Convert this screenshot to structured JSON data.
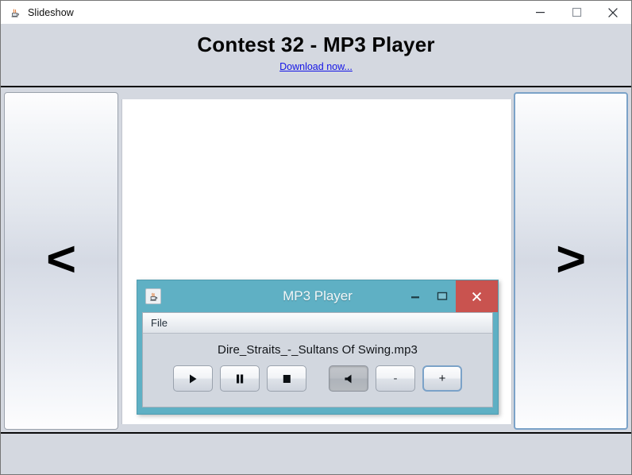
{
  "window": {
    "title": "Slideshow",
    "icon": "java-icon",
    "controls": {
      "minimize": "minimize-icon",
      "maximize": "maximize-icon",
      "close": "close-icon"
    }
  },
  "header": {
    "title": "Contest 32 - MP3 Player",
    "link": "Download now...",
    "link_color": "#1414e6"
  },
  "slideshow": {
    "prev_label": "<",
    "next_label": ">"
  },
  "dialog": {
    "title": "MP3 Player",
    "icon": "java-icon",
    "titlebar_color": "#5fb0c4",
    "close_color": "#c9534f",
    "controls": {
      "minimize": "minimize-icon",
      "maximize": "maximize-icon",
      "close": "close-icon"
    },
    "menu": [
      {
        "label": "File"
      }
    ],
    "now_playing": "Dire_Straits_-_Sultans Of Swing.mp3",
    "buttons": [
      {
        "name": "play-button",
        "icon": "play-icon",
        "state": "normal"
      },
      {
        "name": "pause-button",
        "icon": "pause-icon",
        "state": "normal"
      },
      {
        "name": "stop-button",
        "icon": "stop-icon",
        "state": "normal"
      },
      {
        "name": "mute-button",
        "icon": "speaker-icon",
        "state": "pressed"
      },
      {
        "name": "volume-down-button",
        "icon": "minus-icon",
        "label": "-",
        "state": "normal"
      },
      {
        "name": "volume-up-button",
        "icon": "plus-icon",
        "label": "+",
        "state": "focused"
      }
    ]
  }
}
